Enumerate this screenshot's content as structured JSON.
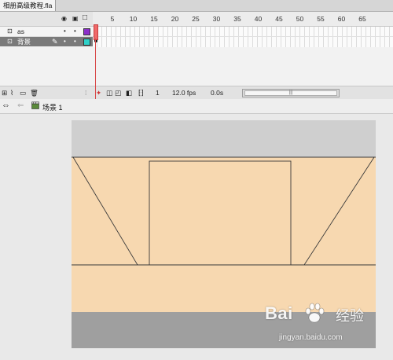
{
  "document": {
    "tab_title": "相册高级教程.fla"
  },
  "timeline": {
    "frame_ticks": [
      "5",
      "10",
      "15",
      "20",
      "25",
      "30",
      "35",
      "40",
      "45",
      "50",
      "55",
      "60",
      "65"
    ],
    "layers": [
      {
        "name": "as",
        "visible_dot": "•",
        "lock_dot": "•",
        "outline_color": "#8b2fc9",
        "selected": false
      },
      {
        "name": "背景",
        "visible_dot": "•",
        "lock_dot": "•",
        "outline_color": "#2fd0c8",
        "selected": true
      }
    ],
    "footer": {
      "current_frame": "1",
      "frame_rate": "12.0 fps",
      "elapsed_time": "0.0s"
    }
  },
  "editbar": {
    "scene_label": "场景 1"
  },
  "stage": {
    "colors": {
      "top_band": "#cfcfcf",
      "background": "#f7d8b0",
      "bottom_band": "#9f9f9f",
      "outline": "#3a3a3a"
    }
  },
  "watermark": {
    "brand": "Bai",
    "brand_suffix": "经验",
    "url": "jingyan.baidu.com"
  },
  "icons": {
    "eye": "👁",
    "lock": "🔒",
    "outline": "□",
    "layer": "⊡",
    "pencil": "✎"
  }
}
